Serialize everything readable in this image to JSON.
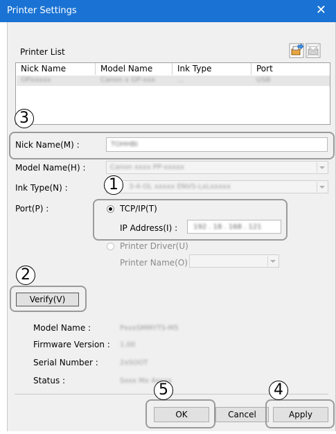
{
  "window": {
    "title": "Printer Settings",
    "close_glyph": "✕"
  },
  "printer_list": {
    "label": "Printer List",
    "columns": [
      "Nick Name",
      "Model Name",
      "Ink Type",
      "Port"
    ],
    "selected_row": [
      "OPxxxxx",
      "Canon x GP-xxx",
      "...",
      "USB"
    ]
  },
  "fields": {
    "nick_name": {
      "label": "Nick Name(M) :",
      "value": "TOHHBI"
    },
    "model_name": {
      "label": "Model Name(H) :",
      "value": "Canon xxxx PP-xxxxx"
    },
    "ink_type": {
      "label": "Ink Type(N) :",
      "value": "3-4-OL xxxxx ENVS-LxLxxxxx"
    },
    "port": {
      "label": "Port(P) :",
      "tcpip_label": "TCP/IP(T)",
      "ip_label": "IP Address(I) :",
      "ip_value": "192 . 18 . 168 . 121",
      "driver_label": "Printer Driver(U)",
      "printer_name_label": "Printer Name(O) :",
      "tcpip_selected": true
    }
  },
  "verify": {
    "button_label": "Verify(V)",
    "info": [
      {
        "label": "Model Name :",
        "value": "PxxxSMMYTS-M5"
      },
      {
        "label": "Firmware Version :",
        "value": "1.00"
      },
      {
        "label": "Serial Number :",
        "value": "2xSOOT"
      },
      {
        "label": "Status :",
        "value": "Sxxx Mx 4xxxx"
      }
    ]
  },
  "buttons": {
    "ok": "OK",
    "cancel": "Cancel",
    "apply": "Apply"
  },
  "callouts": {
    "c1": "1",
    "c2": "2",
    "c3": "3",
    "c4": "4",
    "c5": "5"
  },
  "icons": {
    "add": "printer-add-icon",
    "delete": "printer-delete-icon"
  }
}
